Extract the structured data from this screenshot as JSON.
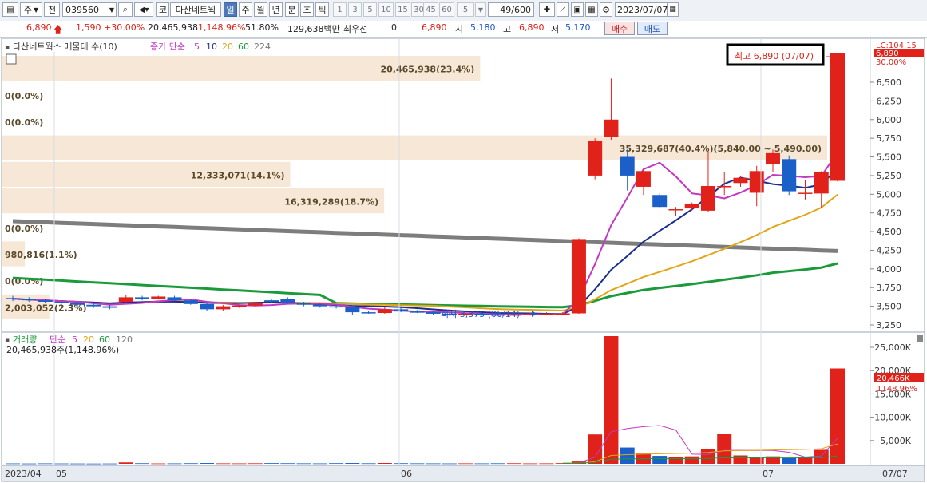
{
  "toolbar": {
    "market_label": "주",
    "prev_label": "전",
    "code": "039560",
    "kospi_label": "코",
    "stock_name": "다산네트웍",
    "periods": [
      "일",
      "주",
      "월",
      "년",
      "분",
      "초",
      "틱"
    ],
    "active_period": "일",
    "intervals": [
      "1",
      "3",
      "5",
      "10",
      "15",
      "30",
      "45",
      "60"
    ],
    "interval_value": "5",
    "count": "49/600",
    "date": "2023/07/07"
  },
  "quote": {
    "price": "6,890",
    "change": "1,590",
    "change_pct": "+30.00%",
    "volume": "20,465,938",
    "volume_pct": "1,148.96%",
    "ratio": "51.80%",
    "amount": "129,638백만",
    "best_label": "최우선",
    "best_value": "0",
    "best_price": "6,890",
    "open_label": "시",
    "open": "5,180",
    "high_label": "고",
    "high": "6,890",
    "low_label": "저",
    "low": "5,170",
    "buy_label": "매수",
    "sell_label": "매도"
  },
  "legend": {
    "title": "다산네트웍스 매물대 수(10)",
    "ma_label": "종가 단순",
    "ma_periods": [
      "5",
      "10",
      "20",
      "60",
      "224"
    ]
  },
  "volume_legend": {
    "title": "거래량",
    "ma_label": "단순",
    "ma_periods": [
      "5",
      "20",
      "60",
      "120"
    ],
    "current": "20,465,938주(1,148.96%)"
  },
  "price_axis": {
    "tick_labels": [
      "6,500",
      "6,250",
      "6,000",
      "5,750",
      "5,500",
      "5,250",
      "5,000",
      "4,750",
      "4,500",
      "4,250",
      "4,000",
      "3,750",
      "3,500",
      "3,250"
    ],
    "top_label": "LC:104.15",
    "current": "6,890",
    "current_pct": "30.00%"
  },
  "volume_axis": {
    "tick_labels": [
      "25,000K",
      "20,000K",
      "15,000K",
      "10,000K",
      "5,000K"
    ],
    "current": "20,466K",
    "current_pct": "1148.96%"
  },
  "x_axis": {
    "labels": [
      "2023/04",
      "05",
      "06",
      "07",
      "07/07"
    ]
  },
  "annotations": {
    "high": "최고 6,890 (07/07)",
    "low": "최저 3,375 (06/14)"
  },
  "chart_data": {
    "type": "candlestick",
    "volume_profile": [
      {
        "label": "20,465,938(23.4%)",
        "fraction": 0.234
      },
      {
        "label": "0(0.0%)",
        "fraction": 0
      },
      {
        "label": "0(0.0%)",
        "fraction": 0
      },
      {
        "label": "35,329,687(40.4%)(5,840.00 ~ 5,490.00)",
        "fraction": 0.404
      },
      {
        "label": "12,333,071(14.1%)",
        "fraction": 0.141
      },
      {
        "label": "16,319,289(18.7%)",
        "fraction": 0.187
      },
      {
        "label": "0(0.0%)",
        "fraction": 0
      },
      {
        "label": "980,816(1.1%)",
        "fraction": 0.011
      },
      {
        "label": "0(0.0%)",
        "fraction": 0
      },
      {
        "label": "2,003,052(2.3%)",
        "fraction": 0.023
      }
    ],
    "candles": [
      [
        3610,
        3640,
        3570,
        3600
      ],
      [
        3600,
        3620,
        3560,
        3580
      ],
      [
        3580,
        3600,
        3540,
        3560
      ],
      [
        3560,
        3580,
        3520,
        3540
      ],
      [
        3540,
        3560,
        3500,
        3520
      ],
      [
        3520,
        3540,
        3480,
        3500
      ],
      [
        3500,
        3520,
        3460,
        3480
      ],
      [
        3560,
        3650,
        3550,
        3620
      ],
      [
        3620,
        3640,
        3580,
        3600
      ],
      [
        3600,
        3640,
        3590,
        3630
      ],
      [
        3620,
        3640,
        3570,
        3580
      ],
      [
        3580,
        3600,
        3520,
        3530
      ],
      [
        3530,
        3550,
        3440,
        3460
      ],
      [
        3460,
        3520,
        3440,
        3500
      ],
      [
        3500,
        3520,
        3480,
        3510
      ],
      [
        3510,
        3560,
        3500,
        3550
      ],
      [
        3580,
        3600,
        3540,
        3560
      ],
      [
        3600,
        3620,
        3530,
        3540
      ],
      [
        3540,
        3560,
        3500,
        3520
      ],
      [
        3520,
        3540,
        3480,
        3500
      ],
      [
        3500,
        3520,
        3470,
        3490
      ],
      [
        3490,
        3510,
        3380,
        3420
      ],
      [
        3420,
        3440,
        3400,
        3410
      ],
      [
        3410,
        3490,
        3400,
        3460
      ],
      [
        3460,
        3480,
        3420,
        3430
      ],
      [
        3430,
        3450,
        3410,
        3420
      ],
      [
        3420,
        3440,
        3380,
        3400
      ],
      [
        3400,
        3420,
        3375,
        3390
      ],
      [
        3390,
        3410,
        3380,
        3400
      ],
      [
        3400,
        3420,
        3375,
        3390
      ],
      [
        3390,
        3400,
        3375,
        3380
      ],
      [
        3380,
        3400,
        3375,
        3390
      ],
      [
        3390,
        3410,
        3375,
        3395
      ],
      [
        3395,
        3420,
        3380,
        3400
      ],
      [
        3400,
        3420,
        3380,
        3405
      ],
      [
        3405,
        4410,
        3400,
        4400
      ],
      [
        5250,
        5750,
        5200,
        5720
      ],
      [
        5770,
        6550,
        5730,
        6000
      ],
      [
        5500,
        5600,
        5050,
        5250
      ],
      [
        5100,
        5330,
        4990,
        5310
      ],
      [
        4990,
        5010,
        4820,
        4830
      ],
      [
        4790,
        4830,
        4710,
        4800
      ],
      [
        4810,
        4890,
        4780,
        4870
      ],
      [
        4780,
        5570,
        4760,
        5110
      ],
      [
        5100,
        5300,
        4990,
        5110
      ],
      [
        5150,
        5250,
        5100,
        5220
      ],
      [
        5020,
        5380,
        4840,
        5310
      ],
      [
        5400,
        5600,
        5300,
        5550
      ],
      [
        5470,
        5520,
        4990,
        5040
      ],
      [
        5010,
        5190,
        4930,
        5020
      ],
      [
        5010,
        5310,
        4810,
        5300
      ],
      [
        5180,
        6890,
        5170,
        6890
      ]
    ],
    "volume": [
      80,
      60,
      90,
      70,
      60,
      50,
      60,
      300,
      120,
      80,
      90,
      120,
      160,
      100,
      90,
      110,
      140,
      120,
      100,
      90,
      130,
      160,
      110,
      170,
      120,
      100,
      90,
      80,
      100,
      90,
      110,
      120,
      90,
      100,
      140,
      500,
      6300,
      27400,
      3500,
      2200,
      1700,
      1400,
      1600,
      3200,
      6500,
      1800,
      1300,
      1600,
      1200,
      1400,
      3000,
      20466
    ]
  }
}
